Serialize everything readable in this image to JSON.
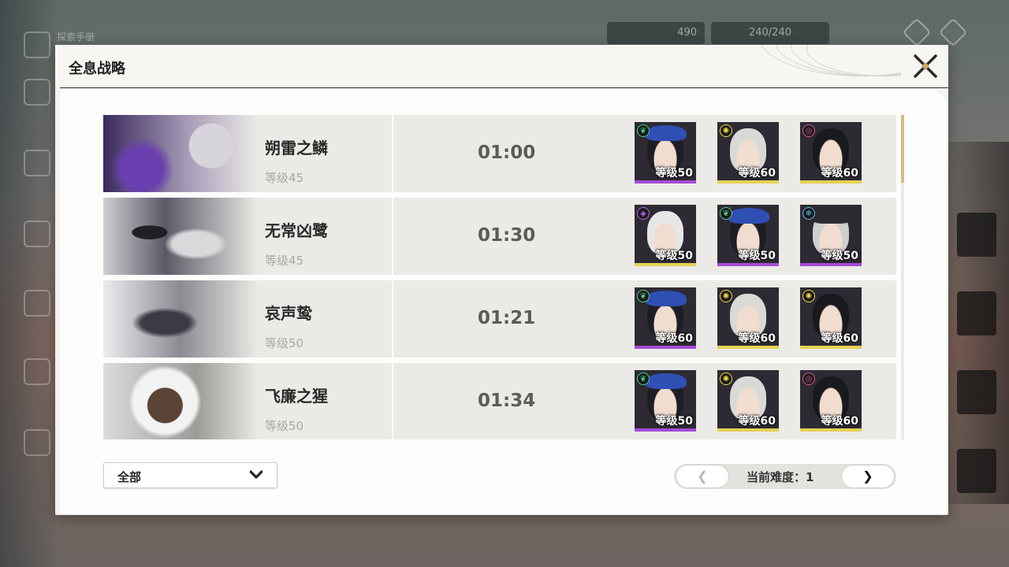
{
  "background": {
    "hud_title": "探索手册",
    "currency": "490",
    "stamina": "240/240"
  },
  "dialog": {
    "title": "全息战略"
  },
  "colors": {
    "accent": "#d8b98a",
    "row_bg": "#ebeae6",
    "rarity_purple": "#a64bd6",
    "rarity_gold": "#e6cf55",
    "element_wind": "#4fd08a",
    "element_light": "#f2dc45",
    "element_havoc": "#e0568e",
    "element_electro": "#b266e8",
    "element_glacio": "#57b8f0"
  },
  "bosses": [
    {
      "name": "朔雷之鳞",
      "level": "等级45",
      "time": "01:00",
      "team": [
        {
          "element": "wind-icon",
          "level": "等级50",
          "rarity": "purple",
          "hair": "#1d1d24",
          "hat": "#2f4fb5"
        },
        {
          "element": "light-icon",
          "level": "等级60",
          "rarity": "gold",
          "hair": "#d9d9d6",
          "hat": ""
        },
        {
          "element": "havoc-icon",
          "level": "等级60",
          "rarity": "gold",
          "hair": "#1a1a1e",
          "hat": ""
        }
      ]
    },
    {
      "name": "无常凶鹭",
      "level": "等级45",
      "time": "01:30",
      "team": [
        {
          "element": "electro-icon",
          "level": "等级50",
          "rarity": "gold",
          "hair": "#e6e6e6",
          "hat": ""
        },
        {
          "element": "wind-icon",
          "level": "等级50",
          "rarity": "purple",
          "hair": "#1d1d24",
          "hat": "#2f4fb5"
        },
        {
          "element": "glacio-icon",
          "level": "等级50",
          "rarity": "purple",
          "hair": "#cfcfcf",
          "hat": "#2c2c30"
        }
      ]
    },
    {
      "name": "哀声鸷",
      "level": "等级50",
      "time": "01:21",
      "team": [
        {
          "element": "wind-icon",
          "level": "等级60",
          "rarity": "purple",
          "hair": "#1d1d24",
          "hat": "#2f4fb5"
        },
        {
          "element": "light-icon",
          "level": "等级60",
          "rarity": "gold",
          "hair": "#d9d9d6",
          "hat": ""
        },
        {
          "element": "light-icon",
          "level": "等级60",
          "rarity": "gold",
          "hair": "#1a1a1e",
          "hat": ""
        }
      ]
    },
    {
      "name": "飞廉之猩",
      "level": "等级50",
      "time": "01:34",
      "team": [
        {
          "element": "wind-icon",
          "level": "等级50",
          "rarity": "purple",
          "hair": "#1d1d24",
          "hat": "#2f4fb5"
        },
        {
          "element": "light-icon",
          "level": "等级60",
          "rarity": "gold",
          "hair": "#d9d9d6",
          "hat": ""
        },
        {
          "element": "havoc-icon",
          "level": "等级60",
          "rarity": "gold",
          "hair": "#1a1a1e",
          "hat": ""
        }
      ]
    }
  ],
  "filter": {
    "selected": "全部"
  },
  "pager": {
    "prev_label": "❮",
    "next_label": "❯",
    "difficulty_label": "当前难度：1"
  }
}
